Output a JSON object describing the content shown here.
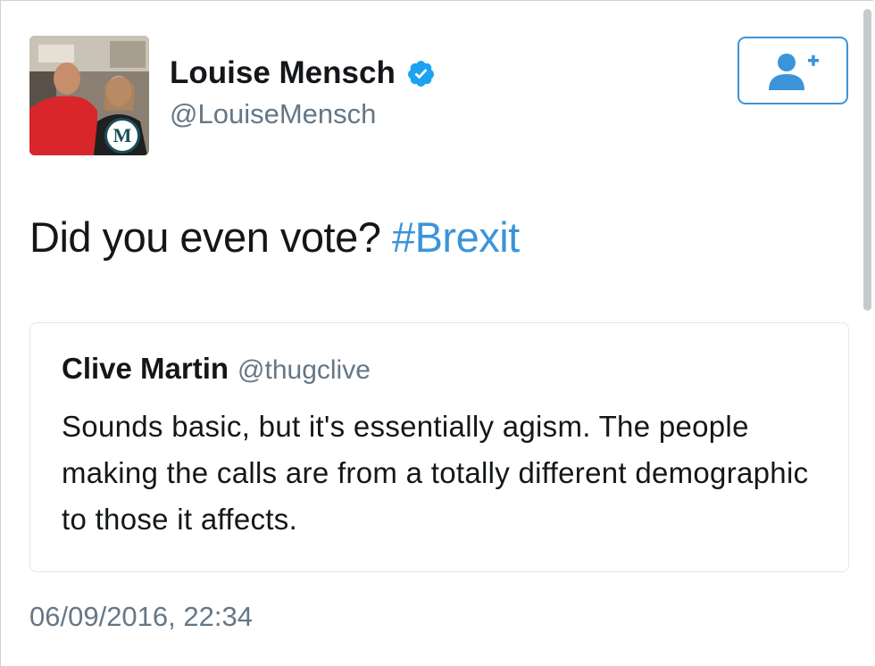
{
  "tweet": {
    "author": {
      "display_name": "Louise Mensch",
      "handle": "@LouiseMensch",
      "verified": true,
      "avatar_badge": "M",
      "avatar_icon": "profile-photo"
    },
    "text": "Did you even vote?",
    "hashtag": "#Brexit",
    "timestamp": "06/09/2016, 22:34",
    "follow_icon": "add-user-icon"
  },
  "quoted_tweet": {
    "display_name": "Clive Martin",
    "handle": "@thugclive",
    "text": "Sounds basic, but it's essentially agism. The people making the calls are from a totally different demographic to those it affects."
  },
  "colors": {
    "link_blue": "#3b94d9",
    "verified_blue": "#1da1f2",
    "muted_gray": "#657786",
    "text_dark": "#14171a"
  }
}
